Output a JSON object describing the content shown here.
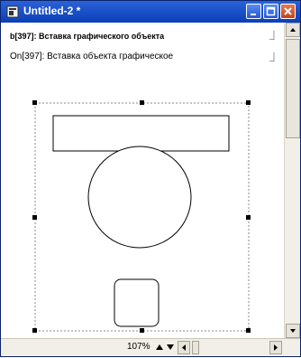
{
  "window": {
    "title": "Untitled-2 *"
  },
  "content": {
    "status_line_1": "b[397]: Вставка графического объекта",
    "status_line_2": "On[397]: Вставка объекта графическое",
    "corner_mark_1": "⏌",
    "corner_mark_2": "⏌"
  },
  "statusbar": {
    "zoom": "107%"
  }
}
